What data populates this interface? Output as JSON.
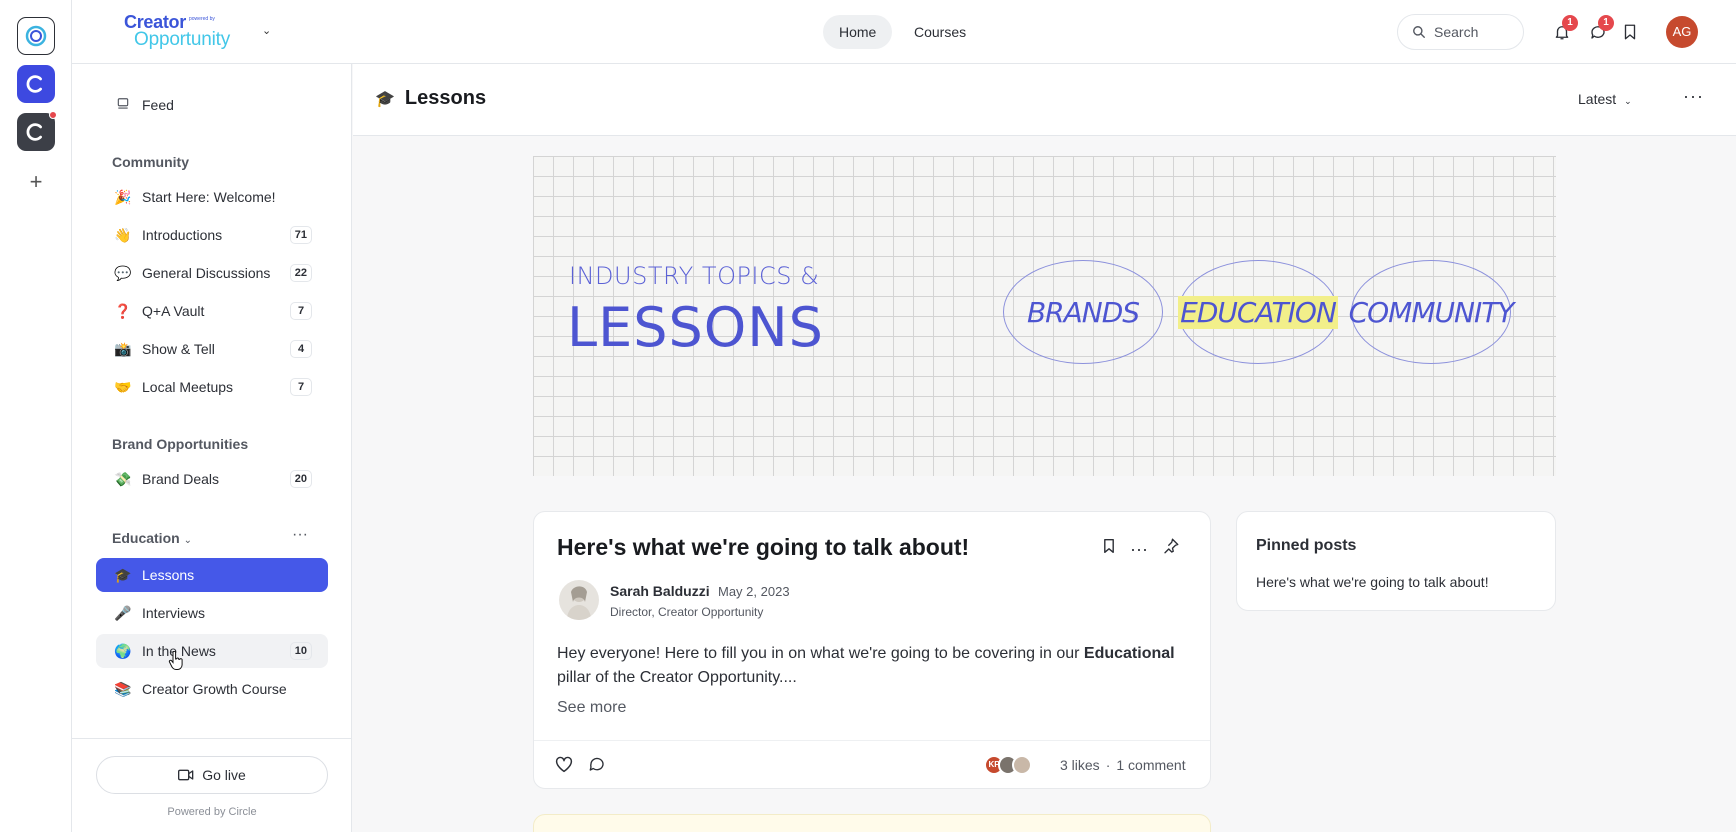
{
  "header": {
    "logo_line1": "Creator",
    "logo_line1_small": "powered by",
    "logo_line2": "Opportunity",
    "nav": [
      "Home",
      "Courses"
    ],
    "search_placeholder": "Search",
    "notifications_count": "1",
    "messages_count": "1",
    "avatar_initials": "AG"
  },
  "sidebar": {
    "feed_label": "Feed",
    "community_heading": "Community",
    "community_items": [
      {
        "emoji": "🎉",
        "label": "Start Here: Welcome!",
        "count": ""
      },
      {
        "emoji": "👋",
        "label": "Introductions",
        "count": "71"
      },
      {
        "emoji": "💬",
        "label": "General Discussions",
        "count": "22"
      },
      {
        "emoji": "❓",
        "label": "Q+A Vault",
        "count": "7"
      },
      {
        "emoji": "📸",
        "label": "Show & Tell",
        "count": "4"
      },
      {
        "emoji": "🤝",
        "label": "Local Meetups",
        "count": "7"
      }
    ],
    "brand_heading": "Brand Opportunities",
    "brand_items": [
      {
        "emoji": "💸",
        "label": "Brand Deals",
        "count": "20"
      }
    ],
    "education_heading": "Education",
    "education_items": [
      {
        "emoji": "🎓",
        "label": "Lessons",
        "count": ""
      },
      {
        "emoji": "🎤",
        "label": "Interviews",
        "count": ""
      },
      {
        "emoji": "🌍",
        "label": "In the News",
        "count": "10"
      },
      {
        "emoji": "📚",
        "label": "Creator Growth Course",
        "count": ""
      }
    ],
    "go_live_label": "Go live",
    "powered_by": "Powered by Circle"
  },
  "content": {
    "title_emoji": "🎓",
    "title": "Lessons",
    "sort_label": "Latest"
  },
  "banner": {
    "small_text": "INDUSTRY TOPICS &",
    "big_text": "LESSONS",
    "pillars": [
      "BRANDS",
      "EDUCATION",
      "COMMUNITY"
    ],
    "highlight_color": "#f2ef8a"
  },
  "post": {
    "title": "Here's what we're going to talk about!",
    "author": "Sarah Balduzzi",
    "date": "May 2, 2023",
    "role": "Director, Creator Opportunity",
    "body_start": "Hey everyone! Here to fill you in on what we're going to be covering in our ",
    "body_bold": "Educational",
    "body_end": " pillar of the Creator Opportunity....",
    "see_more": "See more",
    "liker_initials": "KP",
    "likes": "3 likes",
    "separator": "·",
    "comments": "1 comment"
  },
  "pinned": {
    "title": "Pinned posts",
    "items": [
      "Here's what we're going to talk about!"
    ]
  },
  "colors": {
    "accent": "#4558e8",
    "badge": "#e5484d",
    "avatar": "#c64a2e"
  }
}
